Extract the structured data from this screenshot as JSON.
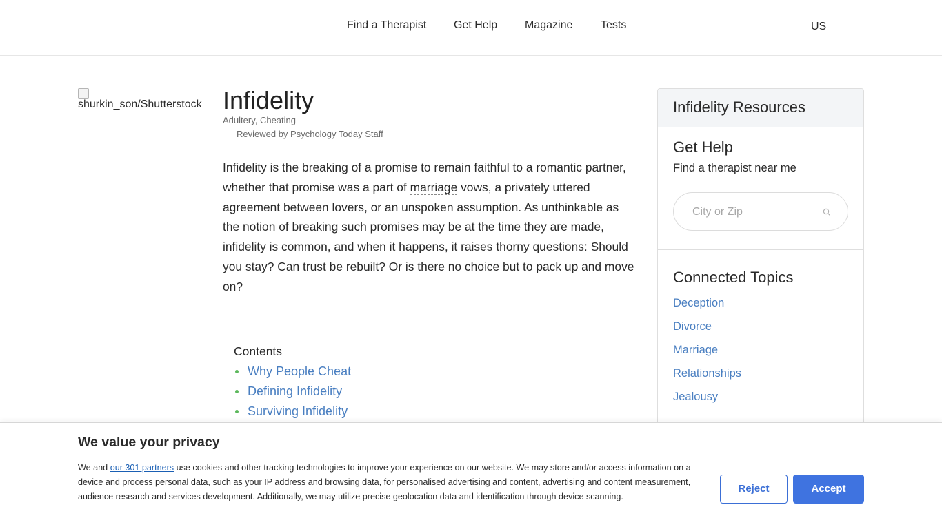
{
  "header": {
    "nav": [
      {
        "label": "Find a Therapist"
      },
      {
        "label": "Get Help"
      },
      {
        "label": "Magazine"
      },
      {
        "label": "Tests"
      }
    ],
    "region": "US"
  },
  "hero_image": {
    "alt": "shurkin_son/Shutterstock"
  },
  "article": {
    "title": "Infidelity",
    "also_known_as": "Adultery, Cheating",
    "reviewed_by": "Reviewed by Psychology Today Staff",
    "intro": {
      "before": "Infidelity is the breaking of a promise to remain faithful to a romantic partner, whether that promise was a part of ",
      "gloss_term": "marriage",
      "after": " vows, a privately uttered agreement between lovers, or an unspoken assumption. As unthinkable as the notion of breaking such promises may be at the time they are made, infidelity is common, and when it happens, it raises thorny questions: Should you stay? Can trust be rebuilt? Or is there no choice but to pack up and move on?"
    },
    "contents": {
      "title": "Contents",
      "items": [
        {
          "label": "Why People Cheat"
        },
        {
          "label": "Defining Infidelity"
        },
        {
          "label": "Surviving Infidelity"
        }
      ]
    }
  },
  "sidebar": {
    "title": "Infidelity Resources",
    "get_help": {
      "title": "Get Help",
      "subtitle": "Find a therapist near me",
      "search_placeholder": "City or Zip",
      "search_value": ""
    },
    "connected_topics": {
      "title": "Connected Topics",
      "items": [
        {
          "label": "Deception"
        },
        {
          "label": "Divorce"
        },
        {
          "label": "Marriage"
        },
        {
          "label": "Relationships"
        },
        {
          "label": "Jealousy"
        }
      ]
    }
  },
  "cookie_banner": {
    "title": "We value your privacy",
    "text_before": "We and ",
    "partners_link": "our 301 partners",
    "text_after": " use cookies and other tracking technologies to improve your experience on our website. We may store and/or access information on a device and process personal data, such as your IP address and browsing data, for personalised advertising and content, advertising and content measurement, audience research and services development. Additionally, we may utilize precise geolocation data and identification through device scanning.",
    "reject_label": "Reject",
    "accept_label": "Accept"
  },
  "colors": {
    "link": "#4a7fc1",
    "bullet": "#5cb85c",
    "accept_button": "#3f73e0",
    "sidebar_header_bg": "#f3f5f7"
  },
  "icons": {
    "search": "search-icon",
    "broken_image": "broken-image-icon"
  }
}
